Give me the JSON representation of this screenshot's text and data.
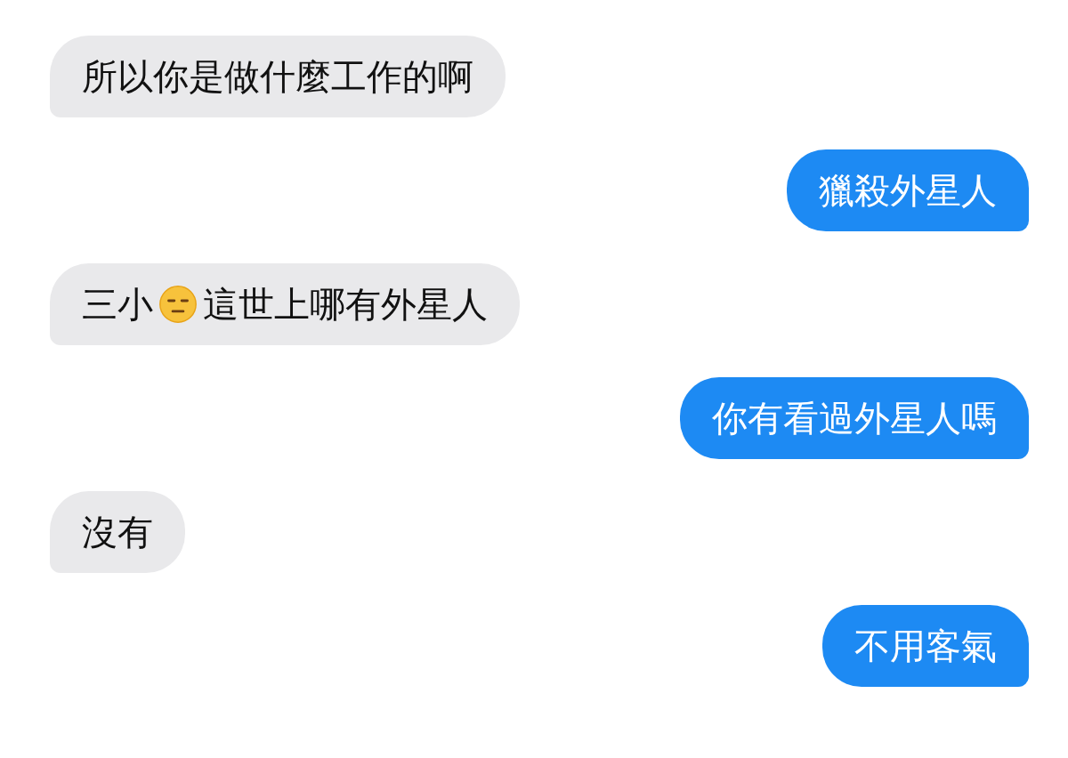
{
  "messages": [
    {
      "kind": "incoming",
      "parts": [
        {
          "kind": "text",
          "text": "所以你是做什麼工作的啊"
        }
      ]
    },
    {
      "kind": "outgoing",
      "parts": [
        {
          "kind": "text",
          "text": "獵殺外星人"
        }
      ]
    },
    {
      "kind": "incoming",
      "parts": [
        {
          "kind": "text",
          "text": "三小"
        },
        {
          "kind": "emoji"
        },
        {
          "kind": "text",
          "text": "這世上哪有外星人"
        }
      ]
    },
    {
      "kind": "outgoing",
      "parts": [
        {
          "kind": "text",
          "text": "你有看過外星人嗎"
        }
      ]
    },
    {
      "kind": "incoming",
      "parts": [
        {
          "kind": "text",
          "text": "沒有"
        }
      ]
    },
    {
      "kind": "outgoing",
      "parts": [
        {
          "kind": "text",
          "text": "不用客氣"
        }
      ]
    }
  ]
}
